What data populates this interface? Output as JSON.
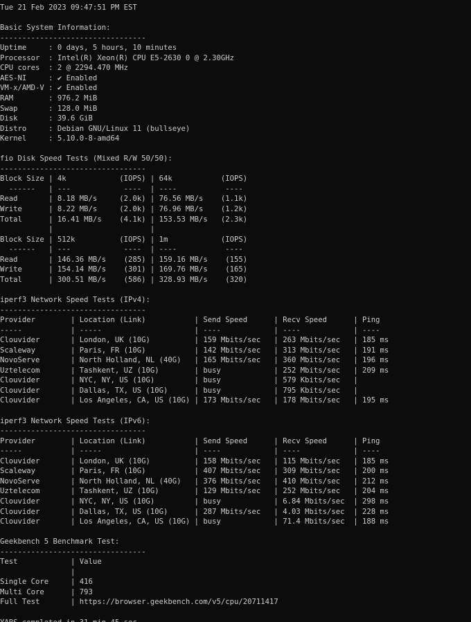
{
  "terminal": {
    "lines": [
      "Tue 21 Feb 2023 09:47:51 PM EST",
      "",
      "Basic System Information:",
      "---------------------------------",
      "Uptime     : 0 days, 5 hours, 10 minutes",
      "Processor  : Intel(R) Xeon(R) CPU E5-2630 0 @ 2.30GHz",
      "CPU cores  : 2 @ 2294.470 MHz",
      "AES-NI     : ✔ Enabled",
      "VM-x/AMD-V : ✔ Enabled",
      "RAM        : 976.2 MiB",
      "Swap       : 128.0 MiB",
      "Disk       : 39.6 GiB",
      "Distro     : Debian GNU/Linux 11 (bullseye)",
      "Kernel     : 5.10.0-8-amd64",
      "",
      "fio Disk Speed Tests (Mixed R/W 50/50):",
      "---------------------------------",
      "Block Size | 4k            (IOPS) | 64k           (IOPS)",
      "  ------   | ---            ----  | ----           ----",
      "Read       | 8.18 MB/s     (2.0k) | 76.56 MB/s    (1.1k)",
      "Write      | 8.22 MB/s     (2.0k) | 76.96 MB/s    (1.2k)",
      "Total      | 16.41 MB/s    (4.1k) | 153.53 MB/s   (2.3k)",
      "           |                      |",
      "Block Size | 512k          (IOPS) | 1m            (IOPS)",
      "  ------   | ---            ----  | ----           ----",
      "Read       | 146.36 MB/s    (285) | 159.16 MB/s    (155)",
      "Write      | 154.14 MB/s    (301) | 169.76 MB/s    (165)",
      "Total      | 300.51 MB/s    (586) | 328.93 MB/s    (320)",
      "",
      "iperf3 Network Speed Tests (IPv4):",
      "---------------------------------",
      "Provider        | Location (Link)           | Send Speed      | Recv Speed      | Ping",
      "-----           | -----                     | ----            | ----            | ----",
      "Clouvider       | London, UK (10G)          | 159 Mbits/sec   | 263 Mbits/sec   | 185 ms",
      "Scaleway        | Paris, FR (10G)           | 142 Mbits/sec   | 313 Mbits/sec   | 191 ms",
      "NovoServe       | North Holland, NL (40G)   | 165 Mbits/sec   | 360 Mbits/sec   | 196 ms",
      "Uztelecom       | Tashkent, UZ (10G)        | busy            | 252 Mbits/sec   | 209 ms",
      "Clouvider       | NYC, NY, US (10G)         | busy            | 579 Kbits/sec   |",
      "Clouvider       | Dallas, TX, US (10G)      | busy            | 795 Kbits/sec   |",
      "Clouvider       | Los Angeles, CA, US (10G) | 173 Mbits/sec   | 178 Mbits/sec   | 195 ms",
      "",
      "iperf3 Network Speed Tests (IPv6):",
      "---------------------------------",
      "Provider        | Location (Link)           | Send Speed      | Recv Speed      | Ping",
      "-----           | -----                     | ----            | ----            | ----",
      "Clouvider       | London, UK (10G)          | 158 Mbits/sec   | 115 Mbits/sec   | 185 ms",
      "Scaleway        | Paris, FR (10G)           | 407 Mbits/sec   | 309 Mbits/sec   | 200 ms",
      "NovoServe       | North Holland, NL (40G)   | 376 Mbits/sec   | 410 Mbits/sec   | 212 ms",
      "Uztelecom       | Tashkent, UZ (10G)        | 129 Mbits/sec   | 252 Mbits/sec   | 204 ms",
      "Clouvider       | NYC, NY, US (10G)         | busy            | 6.84 Mbits/sec  | 298 ms",
      "Clouvider       | Dallas, TX, US (10G)      | 287 Mbits/sec   | 4.03 Mbits/sec  | 228 ms",
      "Clouvider       | Los Angeles, CA, US (10G) | busy            | 71.4 Mbits/sec  | 188 ms",
      "",
      "Geekbench 5 Benchmark Test:",
      "---------------------------------",
      "Test            | Value",
      "                |",
      "Single Core     | 416",
      "Multi Core      | 793",
      "Full Test       | https://browser.geekbench.com/v5/cpu/20711417",
      "",
      "YABS completed in 31 min 45 sec"
    ]
  }
}
